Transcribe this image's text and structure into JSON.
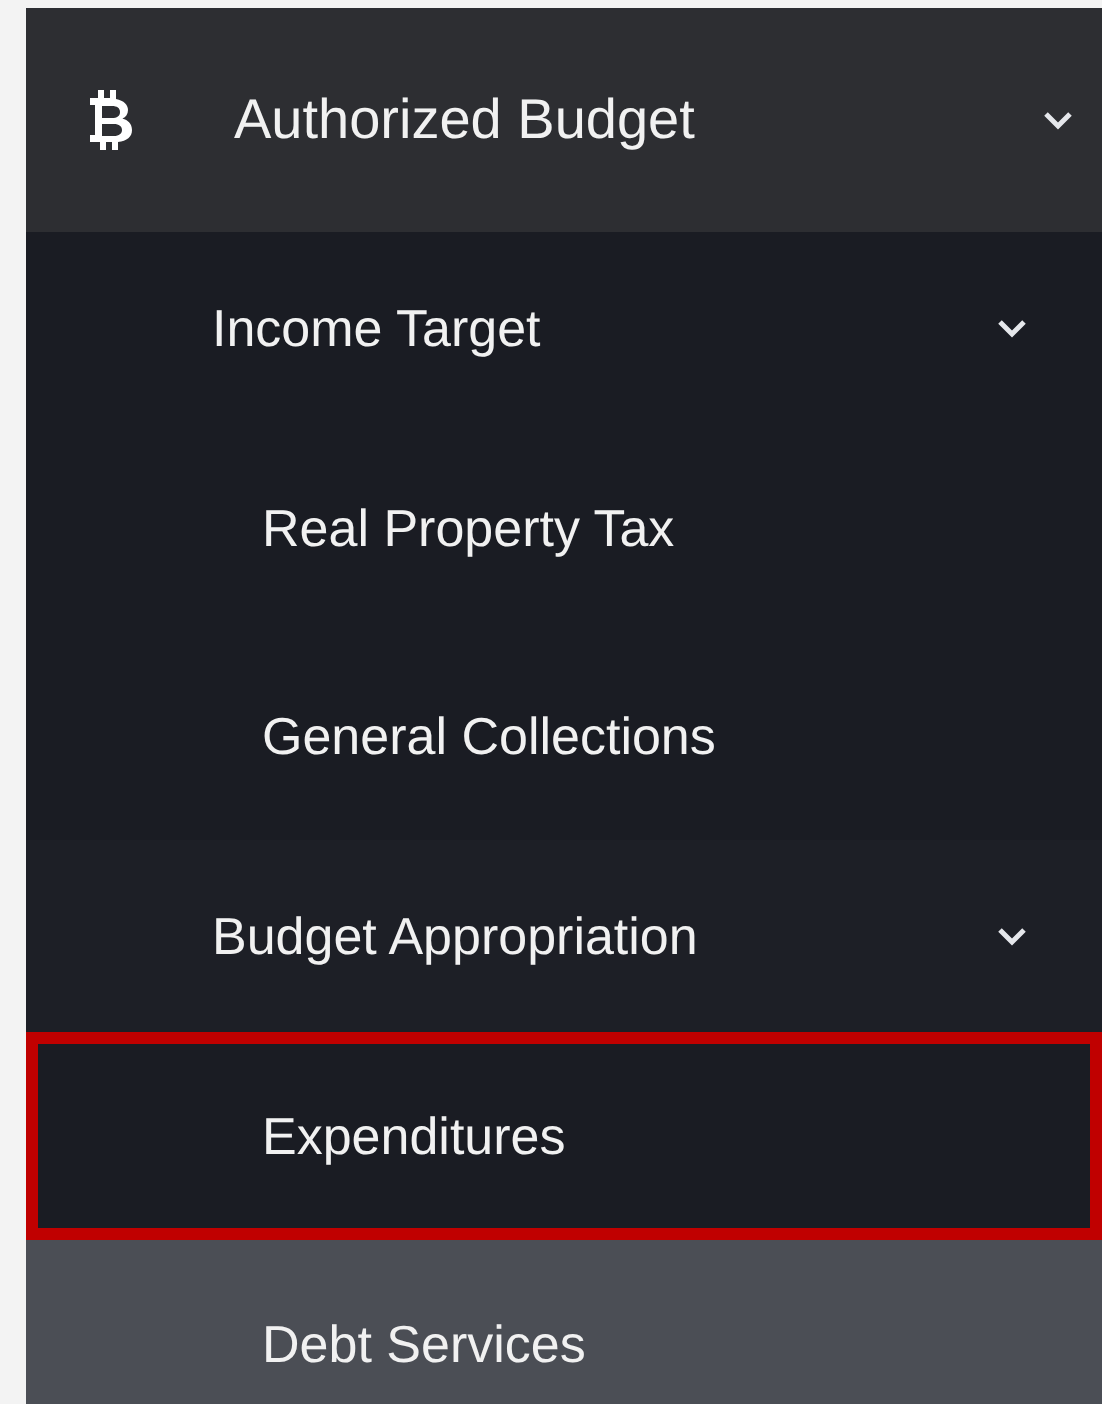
{
  "menu": {
    "label": "Authorized Budget",
    "expanded": true,
    "children": [
      {
        "label": "Income Target",
        "expanded": true,
        "children": [
          {
            "label": "Real Property Tax",
            "highlighted": false,
            "hovered": false
          },
          {
            "label": "General Collections",
            "highlighted": false,
            "hovered": false
          }
        ]
      },
      {
        "label": "Budget Appropriation",
        "expanded": true,
        "children": [
          {
            "label": "Expenditures",
            "highlighted": true,
            "hovered": false
          },
          {
            "label": "Debt Services",
            "highlighted": false,
            "hovered": true
          }
        ]
      }
    ]
  }
}
